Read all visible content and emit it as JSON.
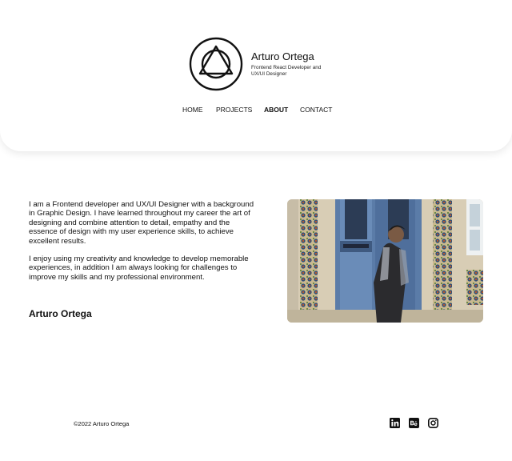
{
  "brand": {
    "name": "Arturo Ortega",
    "tagline": "Frontend React Developer and UX/UI Designer"
  },
  "nav": {
    "items": [
      {
        "label": "HOME",
        "active": false
      },
      {
        "label": "PROJECTS",
        "active": false
      },
      {
        "label": "ABOUT",
        "active": true
      },
      {
        "label": "CONTACT",
        "active": false
      }
    ]
  },
  "about": {
    "paragraphs": [
      "I am a Frontend developer and UX/UI Designer with a background in Graphic Design. I have learned throughout my career the art of designing and combine attention to detail, empathy and the essence of design with my user experience skills, to achieve excellent results.",
      "I enjoy using my creativity and knowledge to develop memorable experiences, in addition I am always looking for challenges to improve my skills and my professional environment."
    ],
    "signature": "Arturo Ortega"
  },
  "footer": {
    "copyright": "©2022 Arturo Ortega",
    "social": [
      {
        "icon": "linkedin-icon",
        "glyph": "in"
      },
      {
        "icon": "behance-icon",
        "glyph": "Bē"
      },
      {
        "icon": "instagram-icon",
        "glyph": ""
      }
    ]
  },
  "colors": {
    "text": "#111111",
    "background": "#ffffff",
    "door": "#5b7ca8",
    "wall": "#d9cfb8"
  }
}
